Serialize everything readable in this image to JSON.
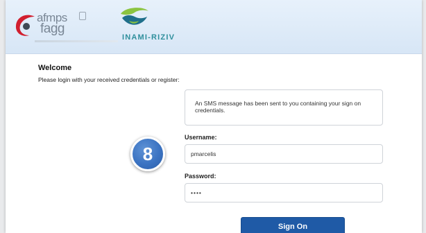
{
  "header": {
    "afmps_logo": {
      "line1": "afmps",
      "line2": "fagg"
    },
    "inami_logo": {
      "text": "INAMI-RIZIV"
    }
  },
  "login": {
    "welcome": "Welcome",
    "instructions": "Please login with your received credentials or register:",
    "sms_message": "An SMS message has been sent to you containing your sign on credentials.",
    "username_label": "Username:",
    "username_value": "pmarcelis",
    "password_label": "Password:",
    "password_value": "••••",
    "submit_label": "Sign On"
  },
  "step_badge": {
    "number": "8"
  },
  "colors": {
    "header_bg": "#dde9f7",
    "button": "#1f5aa6",
    "badge": "#3b73c2",
    "afmps_red": "#d11f2f",
    "inami_green": "#8bc440",
    "inami_blue": "#1f6f8b"
  }
}
